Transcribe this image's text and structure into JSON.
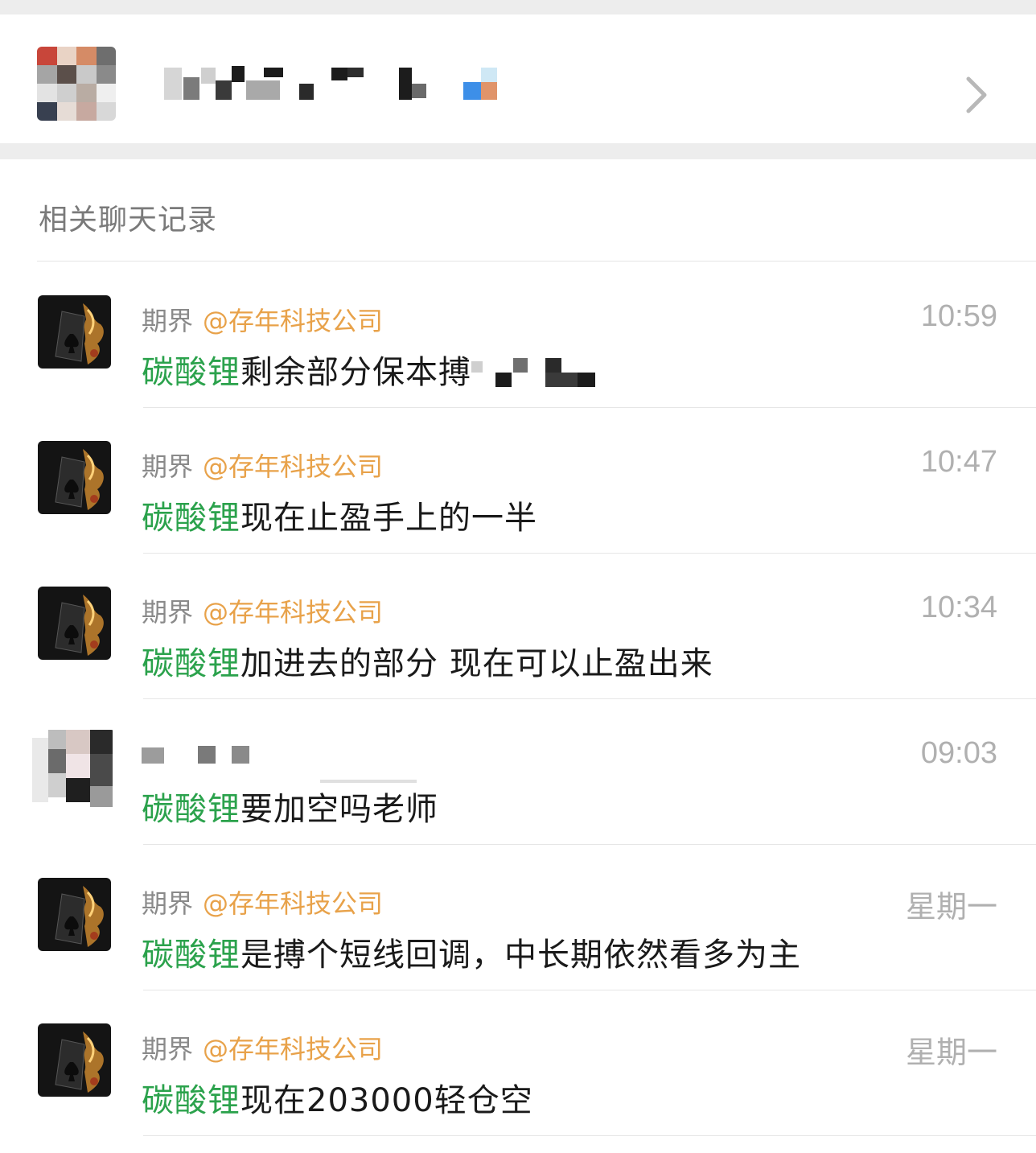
{
  "group": {
    "avatar_icon": "group-avatar",
    "name_redacted": true,
    "chevron_icon": "chevron-right-icon"
  },
  "section": {
    "title": "相关聊天记录"
  },
  "colors": {
    "keyword": "#2ba24c",
    "mention": "#e8a24a",
    "time": "#b0b0b0",
    "band": "#ededed"
  },
  "messages": [
    {
      "sender": "期界",
      "mention": "@存年科技公司",
      "time": "10:59",
      "keyword": "碳酸锂",
      "text": "剩余部分保本搏",
      "avatar": "spade-ace-avatar",
      "redacted_tail": true
    },
    {
      "sender": "期界",
      "mention": "@存年科技公司",
      "time": "10:47",
      "keyword": "碳酸锂",
      "text": "现在止盈手上的一半",
      "avatar": "spade-ace-avatar"
    },
    {
      "sender": "期界",
      "mention": "@存年科技公司",
      "time": "10:34",
      "keyword": "碳酸锂",
      "text": "加进去的部分 现在可以止盈出来",
      "avatar": "spade-ace-avatar"
    },
    {
      "sender": "",
      "mention": "",
      "time": "09:03",
      "keyword": "碳酸锂",
      "text": "要加空吗老师",
      "avatar": "user-avatar",
      "redacted_sender": true
    },
    {
      "sender": "期界",
      "mention": "@存年科技公司",
      "time": "星期一",
      "keyword": "碳酸锂",
      "text": "是搏个短线回调，中长期依然看多为主",
      "avatar": "spade-ace-avatar"
    },
    {
      "sender": "期界",
      "mention": "@存年科技公司",
      "time": "星期一",
      "keyword": "碳酸锂",
      "text": "现在203000轻仓空",
      "avatar": "spade-ace-avatar"
    }
  ]
}
